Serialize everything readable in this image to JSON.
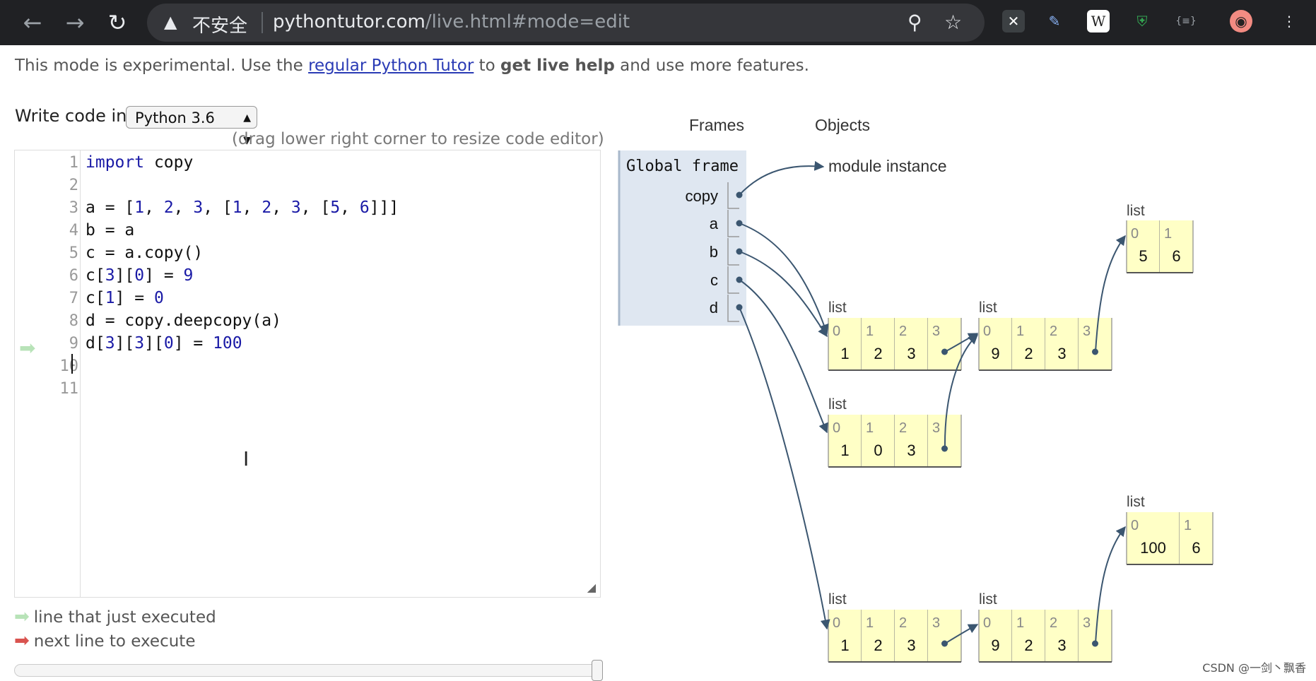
{
  "browser": {
    "back_icon": "back-arrow-icon",
    "forward_icon": "forward-arrow-icon",
    "reload_icon": "reload-icon",
    "insecure_label": "不安全",
    "url_host": "pythontutor.com",
    "url_path": "/live.html#mode=edit"
  },
  "banner": {
    "pre": "This mode is experimental. Use the ",
    "link": "regular Python Tutor",
    "mid": " to ",
    "bold": "get live help",
    "post": " and use more features."
  },
  "editor": {
    "write_label": "Write code in",
    "language": "Python 3.6",
    "resize_hint": "(drag lower right corner to resize code editor)",
    "line_numbers": [
      "1",
      "2",
      "3",
      "4",
      "5",
      "6",
      "7",
      "8",
      "9",
      "10",
      "11"
    ],
    "lines": [
      "import copy",
      "",
      "a = [1, 2, 3, [1, 2, 3, [5, 6]]]",
      "b = a",
      "c = a.copy()",
      "c[3][0] = 9",
      "c[1] = 0",
      "d = copy.deepcopy(a)",
      "d[3][3][0] = 100",
      "",
      ""
    ],
    "current_line": 9
  },
  "legend": {
    "executed": "line that just executed",
    "next": "next line to execute"
  },
  "viz": {
    "frames_header": "Frames",
    "objects_header": "Objects",
    "global_frame": "Global frame",
    "vars": [
      "copy",
      "a",
      "b",
      "c",
      "d"
    ],
    "module_label": "module instance",
    "list_label": "list",
    "lists": {
      "a": {
        "idx": [
          "0",
          "1",
          "2",
          "3"
        ],
        "vals": [
          "1",
          "2",
          "3",
          ""
        ]
      },
      "a3": {
        "idx": [
          "0",
          "1",
          "2",
          "3"
        ],
        "vals": [
          "9",
          "2",
          "3",
          ""
        ]
      },
      "a33": {
        "idx": [
          "0",
          "1"
        ],
        "vals": [
          "5",
          "6"
        ]
      },
      "c": {
        "idx": [
          "0",
          "1",
          "2",
          "3"
        ],
        "vals": [
          "1",
          "0",
          "3",
          ""
        ]
      },
      "d": {
        "idx": [
          "0",
          "1",
          "2",
          "3"
        ],
        "vals": [
          "1",
          "2",
          "3",
          ""
        ]
      },
      "d3": {
        "idx": [
          "0",
          "1",
          "2",
          "3"
        ],
        "vals": [
          "9",
          "2",
          "3",
          ""
        ]
      },
      "d33": {
        "idx": [
          "0",
          "1"
        ],
        "vals": [
          "100",
          "6"
        ]
      }
    }
  },
  "watermark": "CSDN @一剑丶飘香",
  "colors": {
    "frame_bg": "#dfe7f1",
    "list_bg": "#ffffc6",
    "arrow": "#3b5670",
    "executed_arrow": "#b8e3b8",
    "next_arrow": "#d9534f"
  }
}
